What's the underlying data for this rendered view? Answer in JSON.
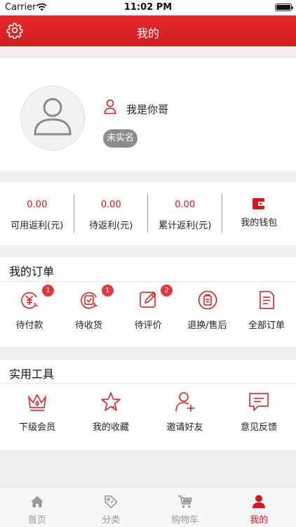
{
  "status_bar": {
    "carrier": "Carrier",
    "time": "11:02 PM"
  },
  "header": {
    "title": "我的"
  },
  "profile": {
    "nickname": "我是你哥",
    "verify_status": "未实名"
  },
  "wallet": {
    "items": [
      {
        "value": "0.00",
        "label": "可用返利(元)"
      },
      {
        "value": "0.00",
        "label": "待返利(元)"
      },
      {
        "value": "0.00",
        "label": "累计返利(元)"
      },
      {
        "label": "我的钱包",
        "icon": "wallet-icon"
      }
    ]
  },
  "orders": {
    "title": "我的订单",
    "items": [
      {
        "label": "待付款",
        "badge": "1",
        "icon": "pending-payment-icon"
      },
      {
        "label": "待收货",
        "badge": "1",
        "icon": "pending-receipt-icon"
      },
      {
        "label": "待评价",
        "badge": "2",
        "icon": "pending-review-icon"
      },
      {
        "label": "退换/售后",
        "icon": "return-service-icon"
      },
      {
        "label": "全部订单",
        "icon": "all-orders-icon"
      }
    ]
  },
  "tools": {
    "title": "实用工具",
    "items": [
      {
        "label": "下级会员",
        "icon": "crown-icon"
      },
      {
        "label": "我的收藏",
        "icon": "star-icon"
      },
      {
        "label": "邀请好友",
        "icon": "invite-friend-icon"
      },
      {
        "label": "意见反馈",
        "icon": "feedback-icon"
      }
    ]
  },
  "tab_bar": {
    "tabs": [
      {
        "label": "首页",
        "icon": "home-icon"
      },
      {
        "label": "分类",
        "icon": "tag-icon"
      },
      {
        "label": "购物车",
        "icon": "cart-icon"
      },
      {
        "label": "我的",
        "icon": "person-icon",
        "active": true
      }
    ]
  },
  "colors": {
    "primary": "#d2191c",
    "inactive": "#999999",
    "background": "#f0f0f0"
  }
}
